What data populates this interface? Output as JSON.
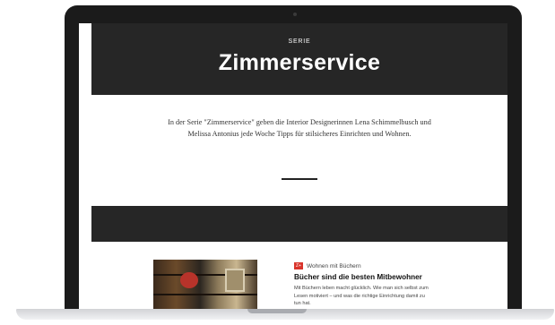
{
  "hero": {
    "kicker": "SERIE",
    "title": "Zimmerservice"
  },
  "intro": {
    "text": "In der Serie \"Zimmerservice\" geben die Interior Designerinnen Lena Schimmelbusch und Melissa Antonius jede Woche Tipps für stilsicheres Einrichten und Wohnen."
  },
  "teaser": {
    "badge": "Z+",
    "category": "Wohnen mit Büchern",
    "headline": "Bücher sind die besten Mitbewohner",
    "body": "Mit Büchern leben macht glücklich. Wie man sich selbst zum Lesen motiviert – und was die richtige Einrichtung damit zu tun hat."
  },
  "colors": {
    "hero_background": "#262626",
    "badge": "#d9342b",
    "laptop_frame": "#1b1b1b"
  },
  "icons": {
    "badge": "zplus-badge-icon"
  }
}
